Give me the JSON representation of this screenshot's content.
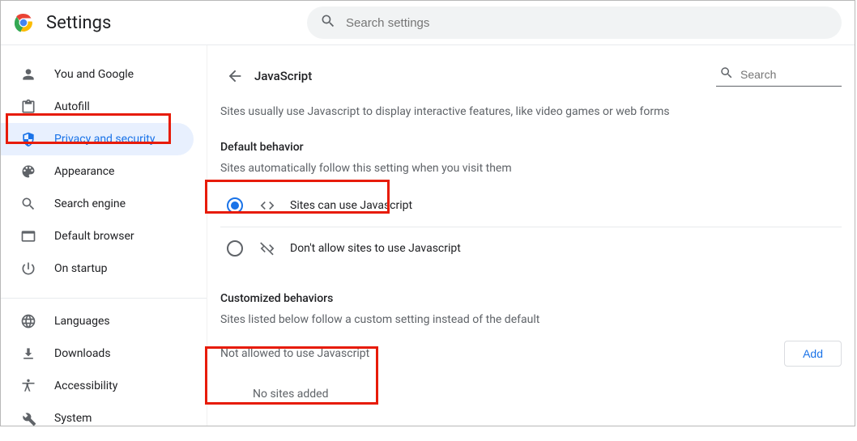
{
  "header": {
    "title": "Settings",
    "search_placeholder": "Search settings"
  },
  "sidebar": {
    "groups": [
      [
        {
          "label": "You and Google"
        },
        {
          "label": "Autofill"
        },
        {
          "label": "Privacy and security"
        },
        {
          "label": "Appearance"
        },
        {
          "label": "Search engine"
        },
        {
          "label": "Default browser"
        },
        {
          "label": "On startup"
        }
      ],
      [
        {
          "label": "Languages"
        },
        {
          "label": "Downloads"
        },
        {
          "label": "Accessibility"
        },
        {
          "label": "System"
        }
      ]
    ]
  },
  "page": {
    "title": "JavaScript",
    "search_placeholder": "Search",
    "description": "Sites usually use Javascript to display interactive features, like video games or web forms",
    "default_behavior": {
      "title": "Default behavior",
      "sub": "Sites automatically follow this setting when you visit them",
      "option_allow": "Sites can use Javascript",
      "option_block": "Don't allow sites to use Javascript"
    },
    "custom": {
      "title": "Customized behaviors",
      "sub": "Sites listed below follow a custom setting instead of the default",
      "not_allowed_title": "Not allowed to use Javascript",
      "add_label": "Add",
      "empty": "No sites added"
    }
  }
}
